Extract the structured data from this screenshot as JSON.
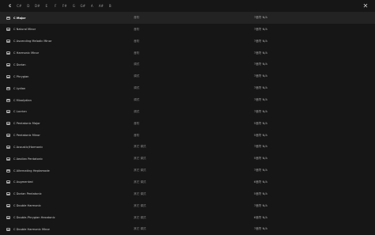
{
  "notes": [
    "C",
    "C#",
    "D",
    "D#",
    "E",
    "F",
    "F#",
    "G",
    "G#",
    "A",
    "A#",
    "B"
  ],
  "active_note_index": 0,
  "close_symbol": "✕",
  "scales": [
    {
      "name": "C Major",
      "category": "音阶",
      "count": "7音符 N/A"
    },
    {
      "name": "C Natural Minor",
      "category": "音阶",
      "count": "7音符 N/A"
    },
    {
      "name": "C Ascending Melodic Minor",
      "category": "音阶",
      "count": "7音符 N/A"
    },
    {
      "name": "C Harmonic Minor",
      "category": "音阶",
      "count": "7音符 N/A"
    },
    {
      "name": "C Dorian",
      "category": "调式",
      "count": "7音符 N/A"
    },
    {
      "name": "C Phrygian",
      "category": "调式",
      "count": "7音符 N/A"
    },
    {
      "name": "C Lydian",
      "category": "调式",
      "count": "7音符 N/A"
    },
    {
      "name": "C Mixolydian",
      "category": "调式",
      "count": "7音符 N/A"
    },
    {
      "name": "C Locrian",
      "category": "调式",
      "count": "7音符 N/A"
    },
    {
      "name": "C Pentatonic Major",
      "category": "音阶",
      "count": "5音符 N/A"
    },
    {
      "name": "C Pentatonic Minor",
      "category": "音阶",
      "count": "5音符 N/A"
    },
    {
      "name": "C Acoustic/Harmonic",
      "category": "其它 调式",
      "count": "7音符 N/A"
    },
    {
      "name": "C Aeolian Pentatonic",
      "category": "其它 调式",
      "count": "5音符 N/A"
    },
    {
      "name": "C Alternating Heptamode",
      "category": "其它 调式",
      "count": "7音符 N/A"
    },
    {
      "name": "C Augmented",
      "category": "其它 调式",
      "count": "6音符 N/A"
    },
    {
      "name": "C Dorian Pentatonic",
      "category": "其它 调式",
      "count": "5音符 N/A"
    },
    {
      "name": "C Double Harmonic",
      "category": "其它 调式",
      "count": "7音符 N/A"
    },
    {
      "name": "C Double-Phrygian Hexatonic",
      "category": "其它 调式",
      "count": "6音符 N/A"
    },
    {
      "name": "C Double Harmonic Minor",
      "category": "其它 调式",
      "count": "7音符 N/A"
    }
  ]
}
